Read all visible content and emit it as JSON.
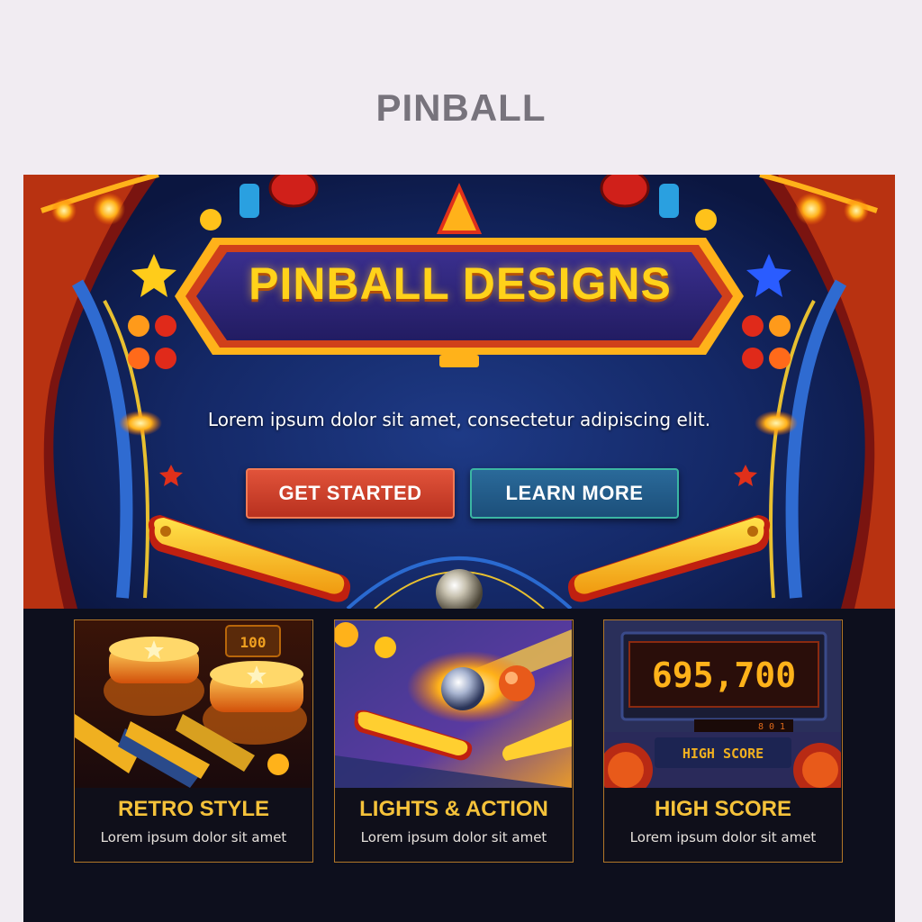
{
  "header": {
    "title": "PINBALL"
  },
  "hero": {
    "sign_title": "PINBALL DESIGNS",
    "subtitle": "Lorem ipsum dolor sit amet, consectetur adipiscing elit.",
    "primary_button": "GET STARTED",
    "secondary_button": "LEARN MORE"
  },
  "cards": [
    {
      "title": "RETRO STYLE",
      "description": "Lorem ipsum dolor sit amet",
      "badge": "100"
    },
    {
      "title": "LIGHTS & ACTION",
      "description": "Lorem ipsum dolor sit amet"
    },
    {
      "title": "HIGH SCORE",
      "description": "Lorem ipsum dolor sit amet",
      "score": "695,700",
      "score_label": "HIGH SCORE",
      "sub_display": "8 0 1"
    }
  ],
  "colors": {
    "page_bg": "#f1ecf2",
    "title_text": "#77737c",
    "hero_bg": "#142866",
    "accent_yellow": "#ffd21a",
    "button_start": "#c93d27",
    "button_learn": "#1f5a86",
    "card_border": "#b27728",
    "card_title": "#f5c23a"
  },
  "icons": [
    "star-icon",
    "flipper-icon",
    "pinball-icon",
    "bumper-icon"
  ]
}
